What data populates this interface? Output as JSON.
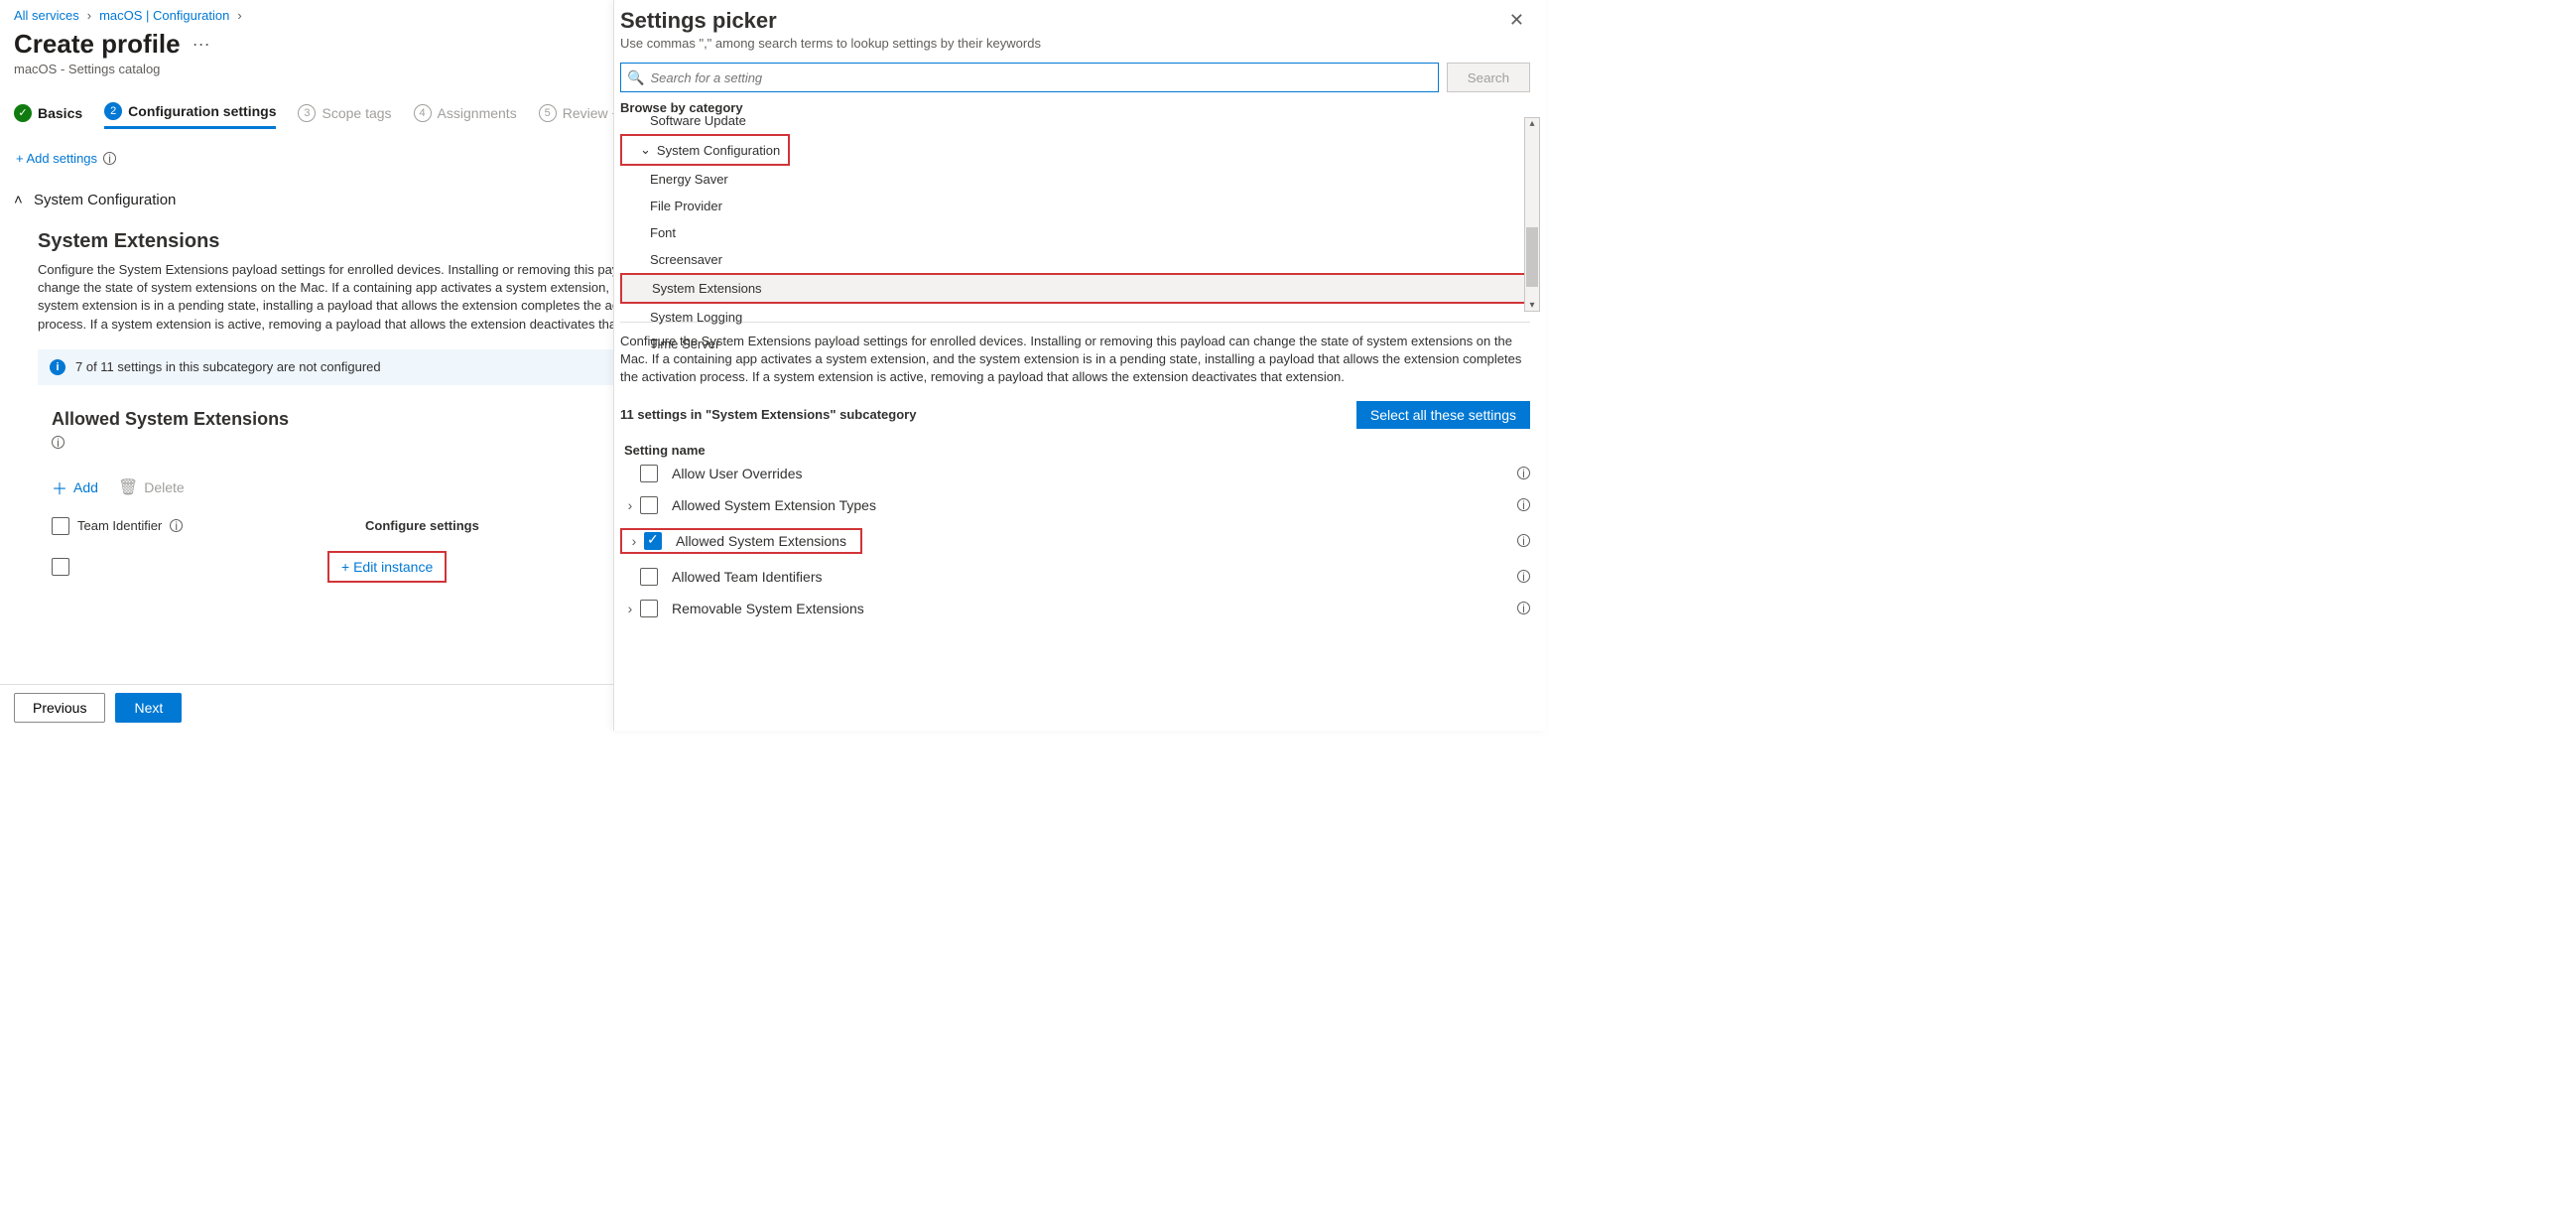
{
  "breadcrumbs": {
    "a": "All services",
    "b": "macOS | Configuration"
  },
  "page": {
    "title": "Create profile",
    "subtitle": "macOS - Settings catalog"
  },
  "wizard": {
    "s1": "Basics",
    "s2": "Configuration settings",
    "s3": "Scope tags",
    "s4": "Assignments",
    "s5": "Review + …"
  },
  "addSettings": "+ Add settings",
  "collapseLabel": "System Configuration",
  "sysExt": {
    "heading": "System Extensions",
    "desc": "Configure the System Extensions payload settings for enrolled devices. Installing or removing this payload can change the state of system extensions on the Mac. If a containing app activates a system extension, and the system extension is in a pending state, installing a payload that allows the extension completes the activation process. If a system extension is active, removing a payload that allows the extension deactivates that extension.",
    "bannerText": "7 of 11 settings in this subcategory are not configured"
  },
  "allowed": {
    "heading": "Allowed System Extensions",
    "add": "Add",
    "delete": "Delete",
    "teamIdCol": "Team Identifier",
    "configCol": "Configure settings",
    "editInstance": "+ Edit instance"
  },
  "footer": {
    "prev": "Previous",
    "next": "Next"
  },
  "panel": {
    "title": "Settings picker",
    "hint": "Use commas \",\" among search terms to lookup settings by their keywords",
    "searchPlaceholder": "Search for a setting",
    "searchBtn": "Search",
    "browseLabel": "Browse by category",
    "truncatedTop": "Software Update",
    "parent": "System Configuration",
    "children": {
      "c1": "Energy Saver",
      "c2": "File Provider",
      "c3": "Font",
      "c4": "Screensaver",
      "c5": "System Extensions",
      "c6": "System Logging",
      "c7": "Time Server"
    },
    "bodyDesc": "Configure the System Extensions payload settings for enrolled devices. Installing or removing this payload can change the state of system extensions on the Mac. If a containing app activates a system extension, and the system extension is in a pending state, installing a payload that allows the extension completes the activation process. If a system extension is active, removing a payload that allows the extension deactivates that extension.",
    "countLabel": "11 settings in \"System Extensions\" subcategory",
    "selectAll": "Select all these settings",
    "settingNameHead": "Setting name",
    "settings": {
      "s1": "Allow User Overrides",
      "s2": "Allowed System Extension Types",
      "s3": "Allowed System Extensions",
      "s4": "Allowed Team Identifiers",
      "s5": "Removable System Extensions"
    }
  }
}
